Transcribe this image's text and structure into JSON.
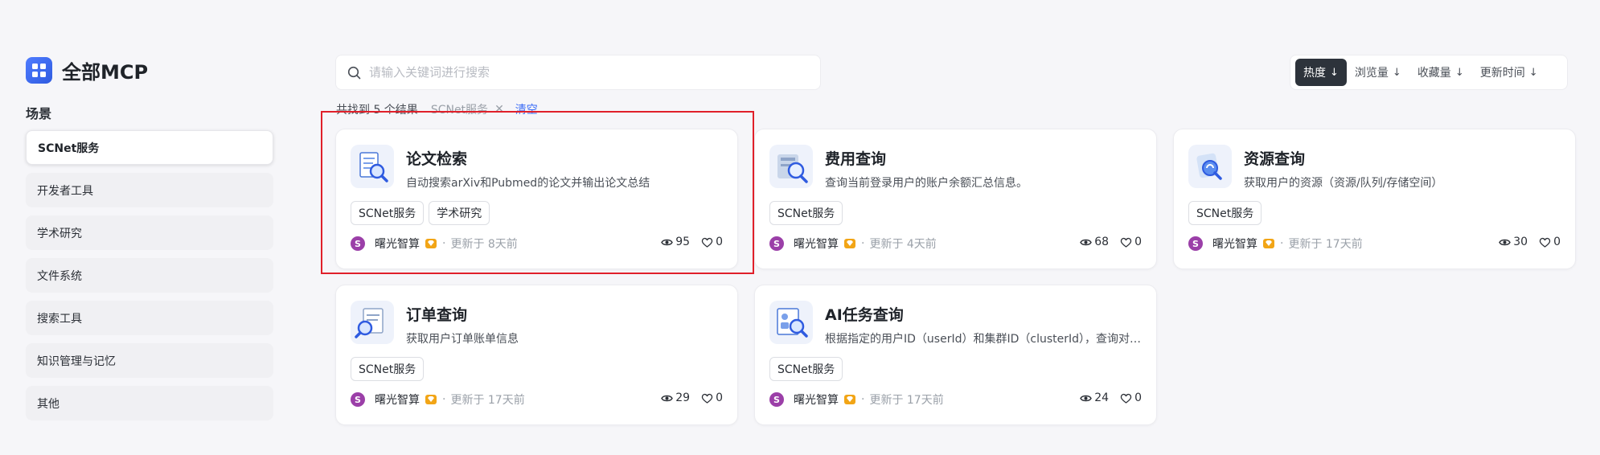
{
  "sidebar": {
    "title": "全部MCP",
    "section_label": "场景",
    "items": [
      {
        "label": "SCNet服务",
        "active": true
      },
      {
        "label": "开发者工具",
        "active": false
      },
      {
        "label": "学术研究",
        "active": false
      },
      {
        "label": "文件系统",
        "active": false
      },
      {
        "label": "搜索工具",
        "active": false
      },
      {
        "label": "知识管理与记忆",
        "active": false
      },
      {
        "label": "其他",
        "active": false
      }
    ]
  },
  "search": {
    "placeholder": "请输入关键词进行搜索",
    "value": "",
    "icon": "search-icon"
  },
  "results": {
    "count_text": "共找到 5 个结果",
    "filter_chip": "SCNet服务",
    "clear_label": "清空"
  },
  "sort": {
    "options": [
      {
        "label": "热度",
        "arrow": "↓",
        "active": true
      },
      {
        "label": "浏览量",
        "arrow": "↓",
        "active": false
      },
      {
        "label": "收藏量",
        "arrow": "↓",
        "active": false
      },
      {
        "label": "更新时间",
        "arrow": "↓",
        "active": false
      }
    ]
  },
  "cards": [
    {
      "title": "论文检索",
      "description": "自动搜索arXiv和Pubmed的论文并输出论文总结",
      "tags": [
        "SCNet服务",
        "学术研究"
      ],
      "avatar_letter": "S",
      "author": "曙光智算",
      "updated": "更新于 8天前",
      "views": "95",
      "likes": "0",
      "icon": "document-search-icon"
    },
    {
      "title": "费用查询",
      "description": "查询当前登录用户的账户余额汇总信息。",
      "tags": [
        "SCNet服务"
      ],
      "avatar_letter": "S",
      "author": "曙光智算",
      "updated": "更新于 4天前",
      "views": "68",
      "likes": "0",
      "icon": "billing-search-icon"
    },
    {
      "title": "资源查询",
      "description": "获取用户的资源（资源/队列/存储空间）",
      "tags": [
        "SCNet服务"
      ],
      "avatar_letter": "S",
      "author": "曙光智算",
      "updated": "更新于 17天前",
      "views": "30",
      "likes": "0",
      "icon": "resource-search-icon"
    },
    {
      "title": "订单查询",
      "description": "获取用户订单账单信息",
      "tags": [
        "SCNet服务"
      ],
      "avatar_letter": "S",
      "author": "曙光智算",
      "updated": "更新于 17天前",
      "views": "29",
      "likes": "0",
      "icon": "order-search-icon"
    },
    {
      "title": "AI任务查询",
      "description": "根据指定的用户ID（userId）和集群ID（clusterId），查询对…",
      "tags": [
        "SCNet服务"
      ],
      "avatar_letter": "S",
      "author": "曙光智算",
      "updated": "更新于 17天前",
      "views": "24",
      "likes": "0",
      "icon": "ai-task-search-icon"
    }
  ],
  "colors": {
    "accent": "#3b6cf6",
    "sort_active_bg": "#2d333b",
    "avatar": "#9b3fa8",
    "badge": "#f2a516",
    "highlight": "#e0202a"
  }
}
